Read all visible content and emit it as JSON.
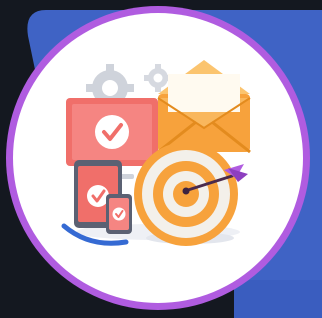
{
  "illustration": {
    "icon": "marketing-target-icon",
    "colors": {
      "background": "#141820",
      "panel": "#3f63c5",
      "panel_shadow": "#2c4aa0",
      "ring": "#b05ce0",
      "circle": "#ffffff",
      "accent_red": "#f06f6a",
      "accent_orange": "#f7a23c",
      "blue": "#356ad3",
      "gear": "#cfd3db"
    }
  }
}
